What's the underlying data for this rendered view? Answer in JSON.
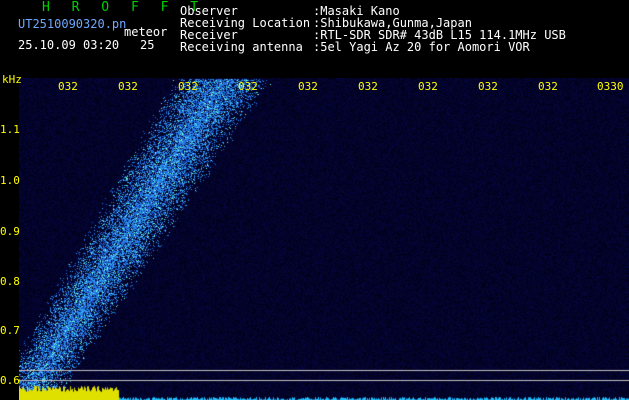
{
  "header": {
    "app_title": "H R O F F T",
    "filename": "UT2510090320.pn",
    "event_type": "meteor",
    "date_time": "25.10.09 03:20",
    "count": "25",
    "fields": [
      {
        "label": "Observer",
        "value": ":Masaki Kano"
      },
      {
        "label": "Receiving Location",
        "value": ":Shibukawa,Gunma,Japan"
      },
      {
        "label": "Receiver",
        "value": ":RTL-SDR SDR# 43dB L15 114.1MHz USB"
      },
      {
        "label": "Receiving antenna",
        "value": ":5el Yagi Az 20 for Aomori VOR"
      }
    ]
  },
  "axes": {
    "y_unit": "kHz",
    "y_ticks": [
      "1.1",
      "1.0",
      "0.9",
      "0.8",
      "0.7",
      "0.6"
    ],
    "x_ticks": [
      "032",
      "032",
      "032",
      "032",
      "032",
      "032",
      "032",
      "032",
      "032",
      "0330"
    ]
  },
  "colors": {
    "title": "#00d000",
    "header_text": "#ffffff",
    "axis_text": "#ffff00",
    "background": "#000000",
    "noise": "#0a0a3a",
    "signal": "#3060ff",
    "signal_hot": "#a0ffe0"
  }
}
